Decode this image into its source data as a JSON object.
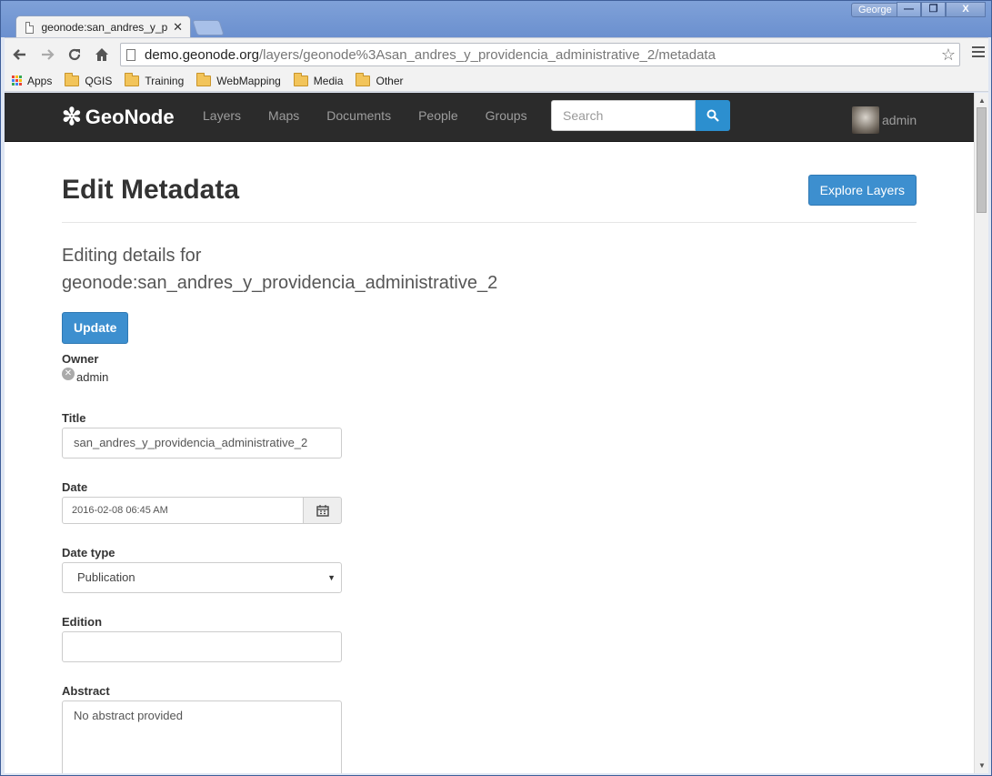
{
  "browser": {
    "tab_title": "geonode:san_andres_y_pro",
    "user_badge": "George",
    "url_host": "demo.geonode.org",
    "url_path": "/layers/geonode%3Asan_andres_y_providencia_administrative_2/metadata",
    "bookmarks": [
      "Apps",
      "QGIS",
      "Training",
      "WebMapping",
      "Media",
      "Other"
    ],
    "window_buttons": [
      "—",
      "❐",
      "X"
    ]
  },
  "site": {
    "brand": "GeoNode",
    "nav": [
      "Layers",
      "Maps",
      "Documents",
      "People",
      "Groups"
    ],
    "search_placeholder": "Search",
    "user": "admin"
  },
  "page": {
    "title": "Edit Metadata",
    "explore_button": "Explore Layers",
    "subtitle_line1": "Editing details for",
    "subtitle_line2": "geonode:san_andres_y_providencia_administrative_2",
    "update_button": "Update"
  },
  "form": {
    "owner_label": "Owner",
    "owner_value": "admin",
    "title_label": "Title",
    "title_value": "san_andres_y_providencia_administrative_2",
    "date_label": "Date",
    "date_value": "2016-02-08 06:45 AM",
    "date_type_label": "Date type",
    "date_type_value": "Publication",
    "edition_label": "Edition",
    "edition_value": "",
    "abstract_label": "Abstract",
    "abstract_value": "No abstract provided"
  }
}
